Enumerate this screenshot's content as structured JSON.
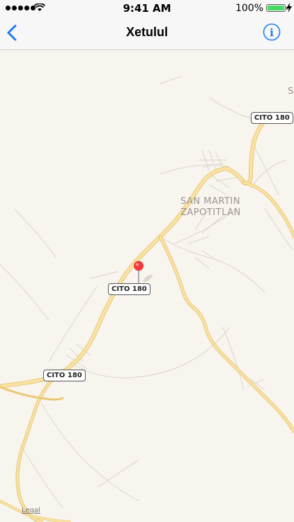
{
  "status_bar": {
    "time": "9:41 AM",
    "battery_percent": "100%",
    "battery_level": 1.0,
    "signal_bars": 5
  },
  "nav": {
    "title": "Xetulul",
    "back_icon": "chevron-left-icon",
    "info_icon": "info-icon",
    "accent_color": "#1a7cf5"
  },
  "map": {
    "town_label_line1": "SAN MARTIN",
    "town_label_line2": "ZAPOTITLAN",
    "edge_label": "S",
    "route_shields": [
      "CITO 180",
      "CITO 180",
      "CITO 180"
    ],
    "pin_color": "#f2393b",
    "road_color": "#f7d98a",
    "legal_label": "Legal"
  }
}
